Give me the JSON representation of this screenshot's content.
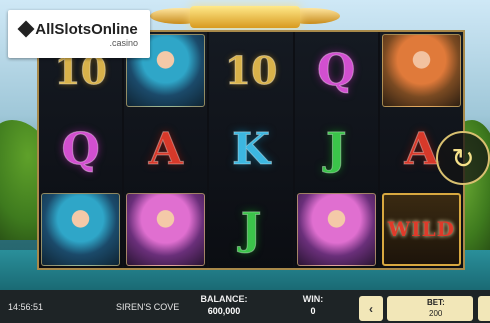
{
  "logo": {
    "main": "AllSlotsOnline",
    "sub": ".casino"
  },
  "reels": [
    [
      "10",
      "Q",
      "siren-blue"
    ],
    [
      "siren-blue",
      "A",
      "siren-pink"
    ],
    [
      "10",
      "K",
      "J"
    ],
    [
      "Q",
      "J",
      "siren-pink"
    ],
    [
      "siren-red",
      "A",
      "WILD"
    ]
  ],
  "wild_label": "WILD",
  "spin_icon": "refresh-icon",
  "bottom_bar": {
    "time": "14:56:51",
    "game_name": "SIREN'S COVE",
    "balance_label": "BALANCE:",
    "balance_value": "600,000",
    "win_label": "WIN:",
    "win_value": "0",
    "bet_label": "BET:",
    "bet_value": "200",
    "bet_decrease": "‹"
  },
  "colors": {
    "frame_gold": "#a8894a",
    "bar_bg": "#1e2426",
    "bet_bg": "#f2e7b8"
  }
}
